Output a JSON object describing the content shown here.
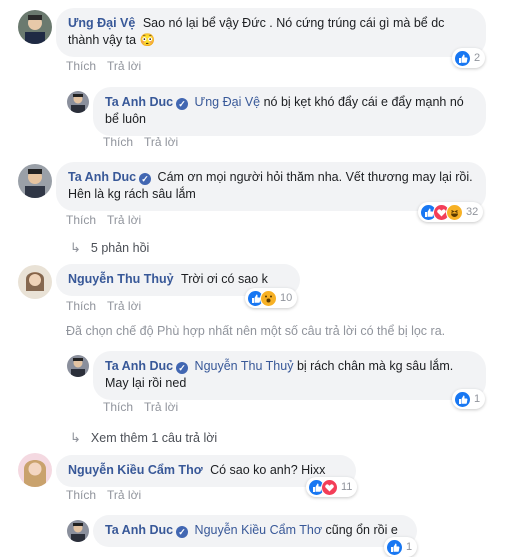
{
  "common": {
    "like": "Thích",
    "reply": "Trả lời"
  },
  "comments": [
    {
      "author": "Ưng Đại Vệ",
      "text": "Sao nó lại bể vậy Đức . Nó cứng trúng cái gì mà bể dc thành vậy ta 😳",
      "reactions": "2",
      "replies": [
        {
          "author": "Ta Anh Duc",
          "tag": "Ưng Đại Vệ",
          "text": " nó bị kẹt khó đẩy cái e đẩy mạnh nó bể luôn"
        }
      ]
    },
    {
      "author": "Ta Anh Duc",
      "text": "Cám ơn mọi người hỏi thăm nha. Vết thương may lại rồi. Hên là kg rách sâu lắm",
      "reactions": "32",
      "replies_link": "5 phản hồi"
    },
    {
      "author": "Nguyễn Thu Thuỷ",
      "text": "Trời ơi có sao k",
      "reactions": "10",
      "filter_note": "Đã chọn chế độ Phù hợp nhất nên một số câu trả lời có thể bị lọc ra.",
      "replies": [
        {
          "author": "Ta Anh Duc",
          "tag": "Nguyễn Thu Thuỷ",
          "text": " bị rách chân mà kg sâu lắm. May lại rồi ned",
          "reactions": "1"
        }
      ],
      "replies_link": "Xem thêm 1 câu trả lời"
    },
    {
      "author": "Nguyễn Kiều Cẩm Thơ",
      "text": "Có sao ko anh? Hixx",
      "reactions": "11",
      "replies": [
        {
          "author": "Ta Anh Duc",
          "tag": "Nguyễn Kiều Cẩm Thơ",
          "text": " cũng ổn rồi e",
          "reactions": "1"
        }
      ]
    }
  ]
}
